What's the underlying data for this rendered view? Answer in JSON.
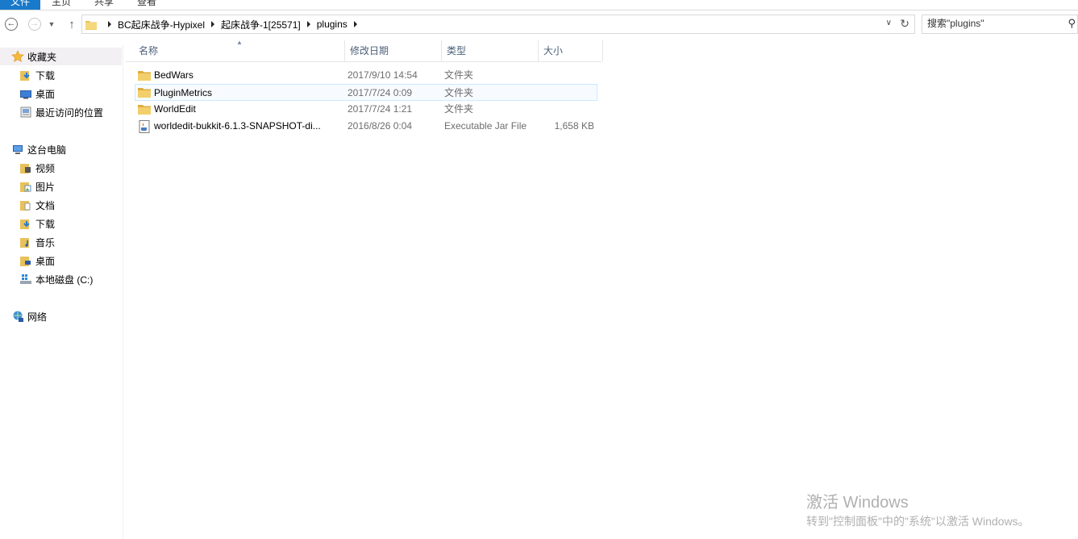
{
  "ribbon": {
    "tabs": [
      "文件",
      "主页",
      "共享",
      "查看"
    ]
  },
  "address": {
    "crumbs": [
      "BC起床战争-Hypixel",
      "起床战争-1[25571]",
      "plugins"
    ]
  },
  "search": {
    "placeholder": "搜索\"plugins\""
  },
  "navpane": {
    "favorites_label": "收藏夹",
    "favorites": [
      "下载",
      "桌面",
      "最近访问的位置"
    ],
    "thispc_label": "这台电脑",
    "thispc": [
      "视频",
      "图片",
      "文档",
      "下载",
      "音乐",
      "桌面",
      "本地磁盘 (C:)"
    ],
    "network_label": "网络"
  },
  "columns": {
    "name": "名称",
    "date": "修改日期",
    "type": "类型",
    "size": "大小"
  },
  "files": [
    {
      "name": "BedWars",
      "date": "2017/9/10 14:54",
      "type": "文件夹",
      "size": ""
    },
    {
      "name": "PluginMetrics",
      "date": "2017/7/24 0:09",
      "type": "文件夹",
      "size": ""
    },
    {
      "name": "WorldEdit",
      "date": "2017/7/24 1:21",
      "type": "文件夹",
      "size": ""
    },
    {
      "name": "worldedit-bukkit-6.1.3-SNAPSHOT-di...",
      "date": "2016/8/26 0:04",
      "type": "Executable Jar File",
      "size": "1,658 KB"
    }
  ],
  "watermark": {
    "title": "激活 Windows",
    "subtitle": "转到\"控制面板\"中的\"系统\"以激活 Windows。"
  },
  "colors": {
    "accent": "#1979ca",
    "folder": "#e8c15a",
    "header_text": "#4c607a",
    "hover_border": "#cde8ff"
  }
}
